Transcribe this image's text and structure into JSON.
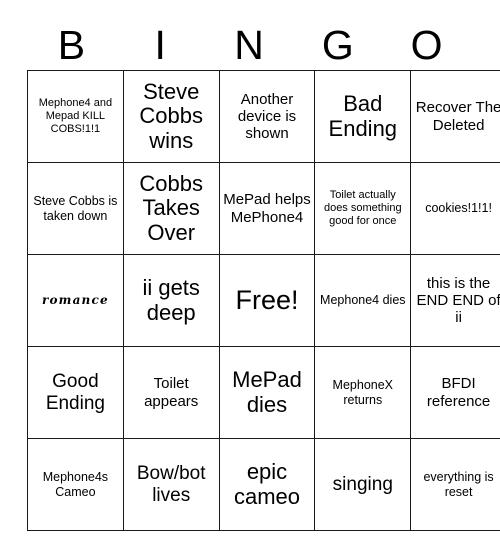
{
  "card": {
    "title": "BINGO",
    "headers": [
      "B",
      "I",
      "N",
      "G",
      "O"
    ],
    "free_space": "Free!",
    "colors": {
      "border": "#1a1a1a",
      "background": "#ffffff",
      "text": "#000000"
    },
    "rows": [
      [
        {
          "text": "Mephone4 and Mepad KILL COBS!1!1",
          "size": "fs-xs",
          "style": "plain"
        },
        {
          "text": "Steve Cobbs wins",
          "size": "fs-xl",
          "style": "plain"
        },
        {
          "text": "Another device is shown",
          "size": "fs-md",
          "style": "plain"
        },
        {
          "text": "Bad Ending",
          "size": "fs-xl",
          "style": "plain"
        },
        {
          "text": "Recover The Deleted",
          "size": "fs-md",
          "style": "plain"
        }
      ],
      [
        {
          "text": "Steve Cobbs is taken down",
          "size": "fs-sm",
          "style": "plain"
        },
        {
          "text": "Cobbs Takes Over",
          "size": "fs-xl",
          "style": "plain"
        },
        {
          "text": "MePad helps MePhone4",
          "size": "fs-md",
          "style": "plain"
        },
        {
          "text": "Toilet actually does something good for once",
          "size": "fs-xs",
          "style": "plain"
        },
        {
          "text": "cookies!1!1!",
          "size": "fs-sm",
          "style": "plain"
        }
      ],
      [
        {
          "text": "romance",
          "size": "fs-xs",
          "style": "style-script"
        },
        {
          "text": "ii gets deep",
          "size": "fs-xl",
          "style": "plain"
        },
        {
          "text": "Free!",
          "size": "fs-free",
          "style": "plain"
        },
        {
          "text": "Mephone4 dies",
          "size": "fs-sm",
          "style": "plain"
        },
        {
          "text": "this is the END END of ii",
          "size": "fs-md",
          "style": "plain"
        }
      ],
      [
        {
          "text": "Good Ending",
          "size": "fs-lg",
          "style": "plain"
        },
        {
          "text": "Toilet appears",
          "size": "fs-md",
          "style": "plain"
        },
        {
          "text": "MePad dies",
          "size": "fs-xl",
          "style": "plain"
        },
        {
          "text": "MephoneX returns",
          "size": "fs-sm",
          "style": "plain"
        },
        {
          "text": "BFDI reference",
          "size": "fs-md",
          "style": "plain"
        }
      ],
      [
        {
          "text": "Mephone4s Cameo",
          "size": "fs-sm",
          "style": "plain"
        },
        {
          "text": "Bow/bot lives",
          "size": "fs-lg",
          "style": "plain"
        },
        {
          "text": "epic cameo",
          "size": "fs-xl",
          "style": "plain"
        },
        {
          "text": "singing",
          "size": "fs-lg",
          "style": "plain"
        },
        {
          "text": "everything is reset",
          "size": "fs-sm",
          "style": "plain"
        }
      ]
    ]
  }
}
